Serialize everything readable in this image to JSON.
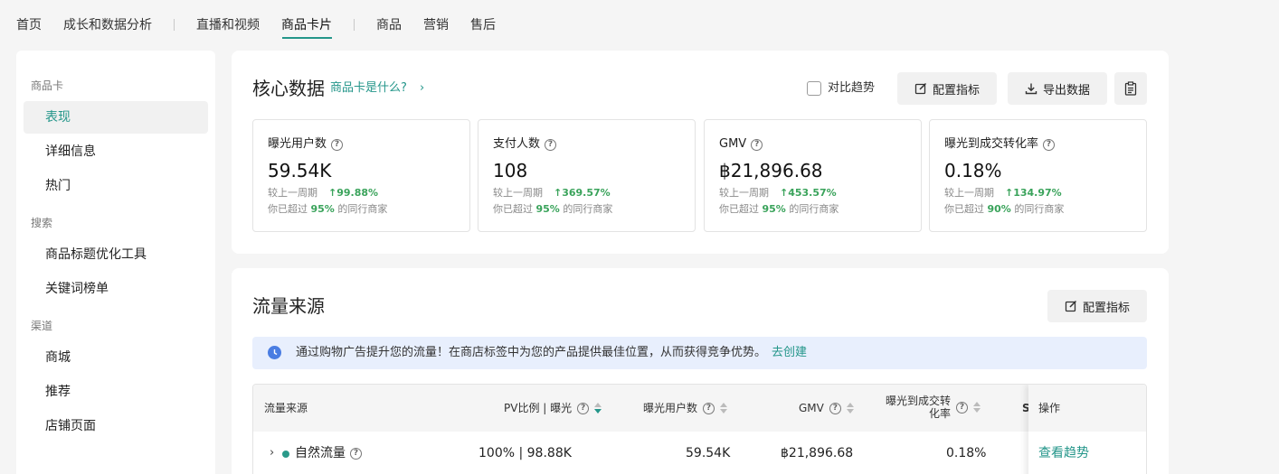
{
  "nav": {
    "items": [
      "首页",
      "成长和数据分析",
      "直播和视频",
      "商品卡片",
      "商品",
      "营销",
      "售后"
    ],
    "active": "商品卡片"
  },
  "sidebar": {
    "groups": [
      {
        "title": "商品卡",
        "items": [
          "表现",
          "详细信息",
          "热门"
        ]
      },
      {
        "title": "搜索",
        "items": [
          "商品标题优化工具",
          "关键词榜单"
        ]
      },
      {
        "title": "渠道",
        "items": [
          "商城",
          "推荐",
          "店铺页面"
        ]
      }
    ],
    "active": "表现"
  },
  "core": {
    "title": "核心数据",
    "help_link": "商品卡是什么?",
    "compare_label": "对比趋势",
    "config_label": "配置指标",
    "export_label": "导出数据",
    "cards": [
      {
        "label": "曝光用户数",
        "value": "59.54K",
        "compare_label": "较上一周期",
        "change": "99.88%",
        "peer_prefix": "你已超过",
        "peer_pct": "95%",
        "peer_suffix": "的同行商家"
      },
      {
        "label": "支付人数",
        "value": "108",
        "compare_label": "较上一周期",
        "change": "369.57%",
        "peer_prefix": "你已超过",
        "peer_pct": "95%",
        "peer_suffix": "的同行商家"
      },
      {
        "label": "GMV",
        "value": "฿21,896.68",
        "compare_label": "较上一周期",
        "change": "453.57%",
        "peer_prefix": "你已超过",
        "peer_pct": "95%",
        "peer_suffix": "的同行商家"
      },
      {
        "label": "曝光到成交转化率",
        "value": "0.18%",
        "compare_label": "较上一周期",
        "change": "134.97%",
        "peer_prefix": "你已超过",
        "peer_pct": "90%",
        "peer_suffix": "的同行商家"
      }
    ]
  },
  "traffic": {
    "title": "流量来源",
    "config_label": "配置指标",
    "banner_text": "通过购物广告提升您的流量！在商店标签中为您的产品提供最佳位置，从而获得竞争优势。",
    "banner_link": "去创建",
    "columns": {
      "source": "流量来源",
      "pv": "PV比例 | 曝光",
      "users": "曝光用户数",
      "gmv": "GMV",
      "conv_line1": "曝光到成交转",
      "conv_line2": "化率",
      "partial": "S",
      "action": "操作"
    },
    "rows": [
      {
        "source": "自然流量",
        "pv": "100% | 98.88K",
        "users": "59.54K",
        "gmv": "฿21,896.68",
        "conv": "0.18%",
        "action": "查看趋势"
      }
    ]
  }
}
